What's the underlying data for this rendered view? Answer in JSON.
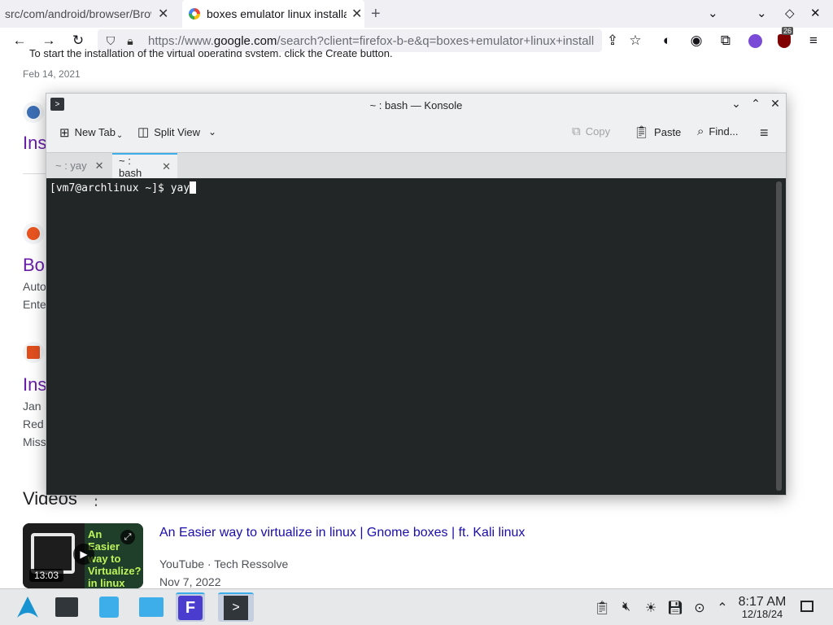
{
  "browser": {
    "tabs": [
      {
        "title": "src/com/android/browser/Browser.java"
      },
      {
        "title": "boxes emulator linux installation"
      }
    ],
    "url": {
      "host": "https://www.google.com",
      "prefix": "https://www.",
      "domain": "google.com",
      "path": "/search?client=firefox-b-e&q=boxes+emulator+linux+install"
    },
    "extension_badge": "26"
  },
  "page": {
    "snippet_top": "To start the installation of the virtual operating system, click the Create button.",
    "date1": "Feb 14, 2021",
    "result1_title_partial": "Ins",
    "result2_title_partial": "Bo",
    "result2_line1": "Auto",
    "result2_line2": "Ente",
    "result3_title_partial": "Ins",
    "result3_line1": "Jan",
    "result3_line2": "Red",
    "result3_line3": "Miss",
    "videos_heading": "Videos",
    "video": {
      "title": "An Easier way to virtualize in linux | Gnome boxes | ft. Kali linux",
      "source": "YouTube · Tech Ressolve",
      "date": "Nov 7, 2022",
      "duration": "13:03",
      "thumb_text": "An Easier way to Virtualize? in linux"
    }
  },
  "konsole": {
    "title": "~ : bash — Konsole",
    "toolbar": {
      "new_tab": "New Tab",
      "split_view": "Split View",
      "copy": "Copy",
      "paste": "Paste",
      "find": "Find..."
    },
    "tabs": [
      {
        "label": "~ : yay"
      },
      {
        "label": "~ : bash"
      }
    ],
    "prompt": "[vm7@archlinux ~]$ ",
    "command": "yay"
  },
  "taskbar": {
    "time": "8:17 AM",
    "date": "12/18/24"
  },
  "colors": {
    "terminal_bg": "#232627",
    "link_visited": "#681da8",
    "kde_accent": "#3daee9"
  }
}
